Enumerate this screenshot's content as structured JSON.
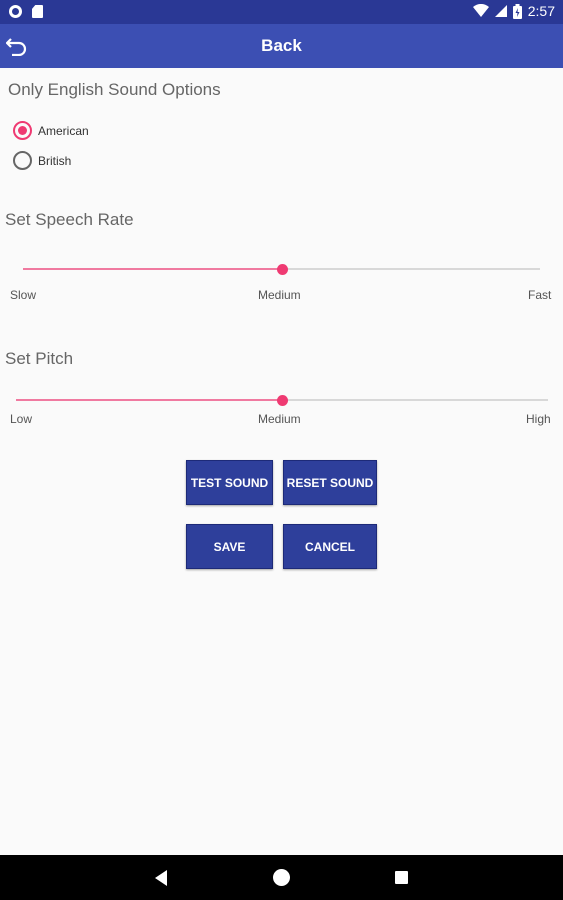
{
  "status_bar": {
    "time": "2:57"
  },
  "app_bar": {
    "title": "Back"
  },
  "sound_options": {
    "title": "Only English Sound Options",
    "options": [
      {
        "label": "American",
        "selected": true
      },
      {
        "label": "British",
        "selected": false
      }
    ]
  },
  "speech_rate": {
    "title": "Set Speech Rate",
    "value_fraction": 0.5,
    "labels": {
      "min": "Slow",
      "mid": "Medium",
      "max": "Fast"
    }
  },
  "pitch": {
    "title": "Set Pitch",
    "value_fraction": 0.5,
    "labels": {
      "min": "Low",
      "mid": "Medium",
      "max": "High"
    }
  },
  "buttons": {
    "test_sound": "TEST SOUND",
    "reset_sound": "RESET SOUND",
    "save": "SAVE",
    "cancel": "CANCEL"
  },
  "colors": {
    "primary_dark": "#2a3895",
    "primary": "#3c4fb3",
    "accent": "#ef3a72",
    "button": "#2e3f9b"
  }
}
